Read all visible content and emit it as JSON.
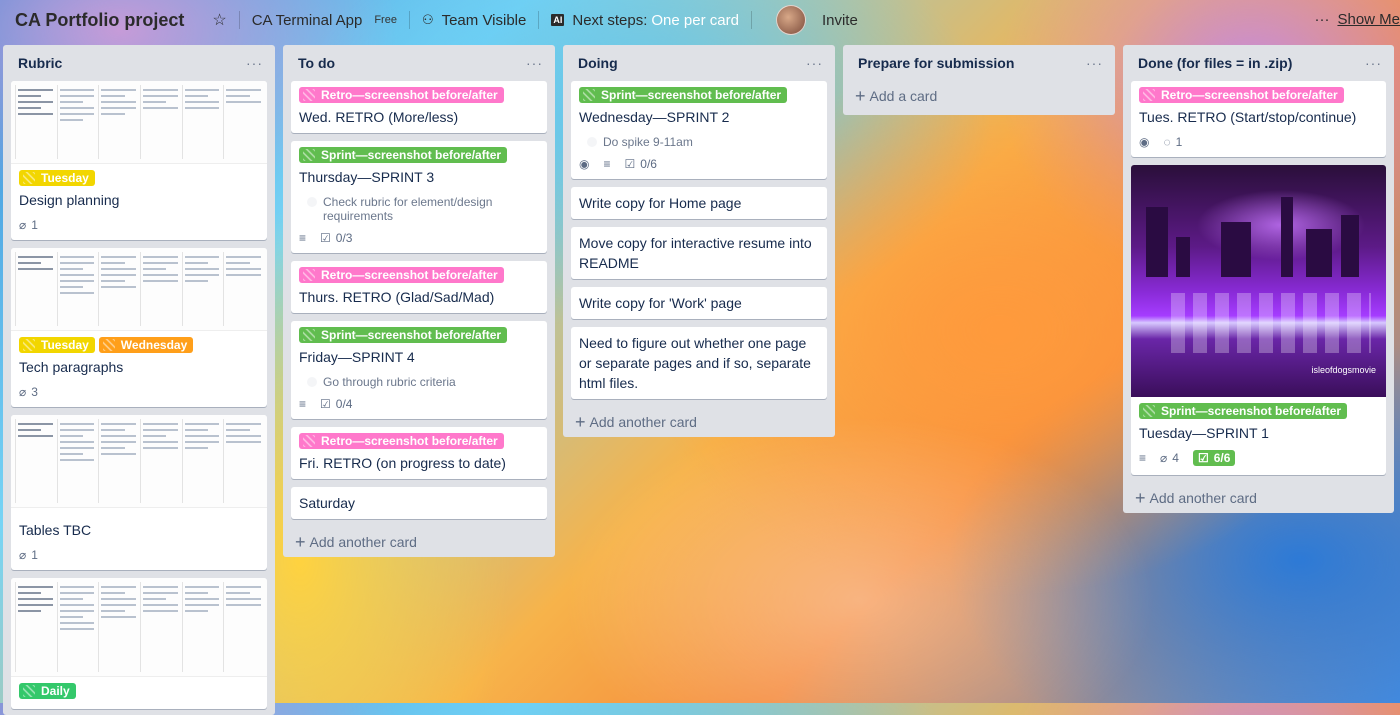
{
  "topbar": {
    "board_title": "CA Portfolio project",
    "team_name": "CA Terminal App",
    "plan": "Free",
    "visibility": "Team Visible",
    "next_steps_label": "Next steps:",
    "next_steps_value": "One per card",
    "invite": "Invite",
    "show_menu": "Show Me"
  },
  "lists": [
    {
      "title": "Rubric",
      "cards": [
        {
          "labels": [
            {
              "text": "Tuesday",
              "color": "yellow"
            }
          ],
          "title": "Design planning",
          "attachments": "1"
        },
        {
          "labels": [
            {
              "text": "Tuesday",
              "color": "yellow"
            },
            {
              "text": "Wednesday",
              "color": "orange"
            }
          ],
          "title": "Tech paragraphs",
          "attachments": "3"
        },
        {
          "labels": [],
          "title": "Tables TBC",
          "attachments": "1"
        },
        {
          "labels": [
            {
              "text": "Daily",
              "color": "teal"
            }
          ],
          "title": "",
          "attachments": ""
        }
      ]
    },
    {
      "title": "To do",
      "add_card": "Add another card",
      "cards": [
        {
          "label": "Retro—screenshot before/after",
          "title": "Wed. RETRO (More/less)"
        },
        {
          "label": "Sprint—screenshot before/after",
          "title": "Thursday—SPRINT 3",
          "checkitem": "Check rubric for element/design requirements",
          "checklist": "0/3"
        },
        {
          "label": "Retro—screenshot before/after",
          "title": "Thurs. RETRO (Glad/Sad/Mad)"
        },
        {
          "label": "Sprint—screenshot before/after",
          "title": "Friday—SPRINT 4",
          "checkitem": "Go through rubric criteria",
          "checklist": "0/4"
        },
        {
          "label": "Retro—screenshot before/after",
          "title": "Fri. RETRO (on progress to date)"
        },
        {
          "title": "Saturday"
        }
      ]
    },
    {
      "title": "Doing",
      "add_card": "Add another card",
      "cards": [
        {
          "label": "Sprint—screenshot before/after",
          "title": "Wednesday—SPRINT 2",
          "checkitem": "Do spike 9-11am",
          "checklist": "0/6"
        },
        {
          "title": "Write copy for Home page"
        },
        {
          "title": "Move copy for interactive resume into README"
        },
        {
          "title": "Write copy for 'Work' page"
        },
        {
          "title": "Need to figure out whether one page or separate pages and if so, separate html files."
        }
      ]
    },
    {
      "title": "Prepare for submission",
      "add_card": "Add a card"
    },
    {
      "title": "Done (for files = in .zip)",
      "add_card": "Add another card",
      "cards": [
        {
          "label": "Retro—screenshot before/after",
          "title": "Tues. RETRO (Start/stop/continue)",
          "comments": "1"
        },
        {
          "label": "Sprint—screenshot before/after",
          "title": "Tuesday—SPRINT 1",
          "attachments": "4",
          "checklist": "6/6",
          "photo_caption": "isleofdogsmovie"
        }
      ]
    }
  ],
  "colors": {
    "label_pink": "#ff78cb",
    "label_green": "#61bd4f",
    "label_yellow": "#f2d600",
    "label_orange": "#ff9f1a",
    "list_bg": "#dfe1e6"
  }
}
